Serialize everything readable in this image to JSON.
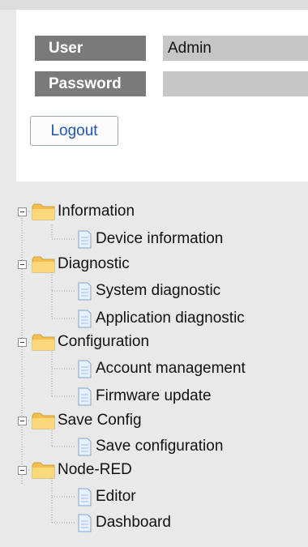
{
  "login": {
    "user_label": "User",
    "user_value": "Admin",
    "password_label": "Password",
    "password_value": "",
    "logout_label": "Logout"
  },
  "nav": {
    "folders": [
      {
        "label": "Information",
        "items": [
          "Device information"
        ]
      },
      {
        "label": "Diagnostic",
        "items": [
          "System diagnostic",
          "Application diagnostic"
        ]
      },
      {
        "label": "Configuration",
        "items": [
          "Account management",
          "Firmware update"
        ]
      },
      {
        "label": "Save Config",
        "items": [
          "Save configuration"
        ]
      },
      {
        "label": "Node-RED",
        "items": [
          "Editor",
          "Dashboard"
        ]
      }
    ]
  },
  "icons": {
    "folder": "folder-icon",
    "document": "document-icon",
    "collapse": "collapse-icon"
  },
  "colors": {
    "label_bg": "#7a7a7a",
    "value_bg": "#c6c6c6",
    "link": "#1f56b8",
    "folder": "#f7c65a",
    "panel_bg": "#e9e9e9"
  }
}
